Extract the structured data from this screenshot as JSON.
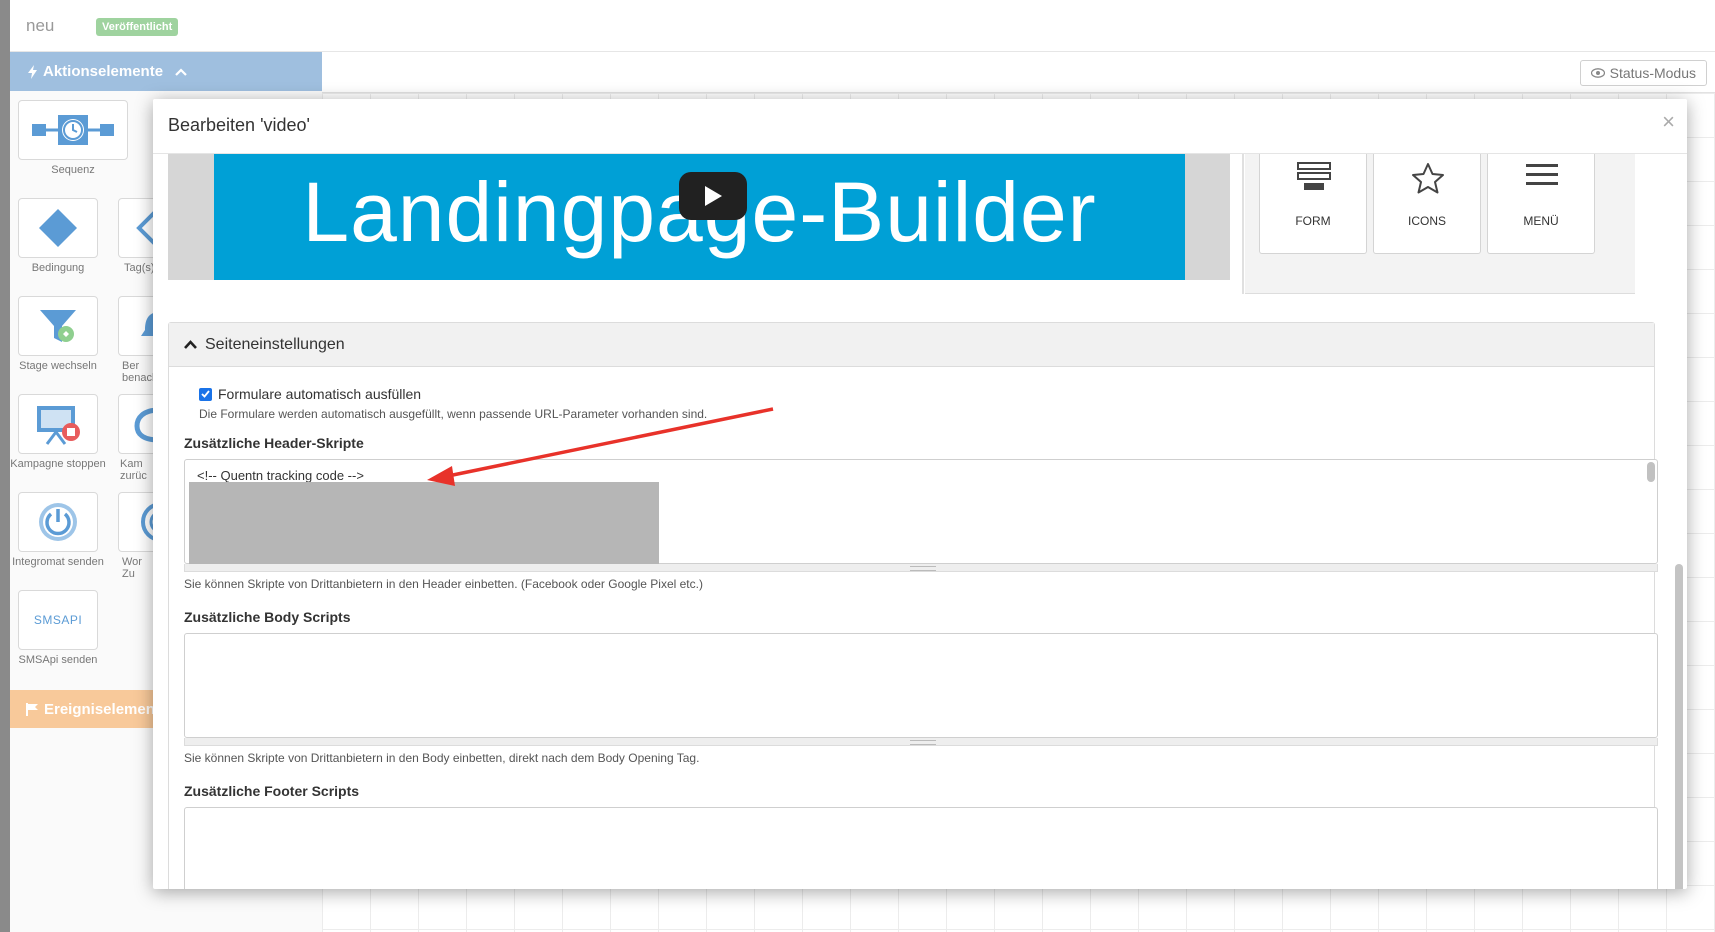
{
  "app": {
    "page_name": "neu",
    "status_badge": "Veröffentlicht",
    "status_mode_button": "Status-Modus"
  },
  "sidebar": {
    "action_section_title": "Aktionselemente",
    "event_section_title": "Ereigniselemen",
    "items": [
      {
        "label": "Sequenz",
        "icon": "sequence-clock-icon"
      },
      {
        "label": "Bedingung",
        "icon": "diamond-icon"
      },
      {
        "label": "Tag(s)",
        "icon": "tag-icon"
      },
      {
        "label": "Stage wechseln",
        "icon": "funnel-icon"
      },
      {
        "label": "Ber benach",
        "icon": "bell-icon"
      },
      {
        "label": "Kampagne stoppen",
        "icon": "stop-campaign-icon"
      },
      {
        "label": "Kam zurüc",
        "icon": "restart-icon"
      },
      {
        "label": "Integromat senden",
        "icon": "power-icon"
      },
      {
        "label": "Wor Zu",
        "icon": "wordpress-icon"
      },
      {
        "label": "SMSApi senden",
        "icon": "smsapi-icon"
      }
    ],
    "smsapi_logo": "SMSAPI"
  },
  "modal": {
    "title": "Bearbeiten 'video'",
    "close_label": "×",
    "video": {
      "banner_text": "Landingpage-Builder"
    },
    "widgets": [
      {
        "label": "FORM",
        "icon": "form-icon"
      },
      {
        "label": "ICONS",
        "icon": "star-icon"
      },
      {
        "label": "MENÜ",
        "icon": "hamburger-menu-icon"
      }
    ],
    "settings": {
      "section_title": "Seiteneinstellungen",
      "autofill": {
        "label": "Formulare automatisch ausfüllen",
        "checked": true,
        "help": "Die Formulare werden automatisch ausgefüllt, wenn passende URL-Parameter vorhanden sind."
      },
      "header_scripts": {
        "label": "Zusätzliche Header-Skripte",
        "value": "<!-- Quentn tracking code -->",
        "help": "Sie können Skripte von Drittanbietern in den Header einbetten. (Facebook oder Google Pixel etc.)"
      },
      "body_scripts": {
        "label": "Zusätzliche Body Scripts",
        "value": "",
        "help": "Sie können Skripte von Drittanbietern in den Body einbetten, direkt nach dem Body Opening Tag."
      },
      "footer_scripts": {
        "label": "Zusätzliche Footer Scripts",
        "value": ""
      }
    }
  },
  "colors": {
    "action_header": "#9fbfdf",
    "event_header": "#f8c99a",
    "video_banner": "#00a0d6",
    "annotation_arrow": "#e8322a",
    "checkbox": "#1a73e8"
  }
}
